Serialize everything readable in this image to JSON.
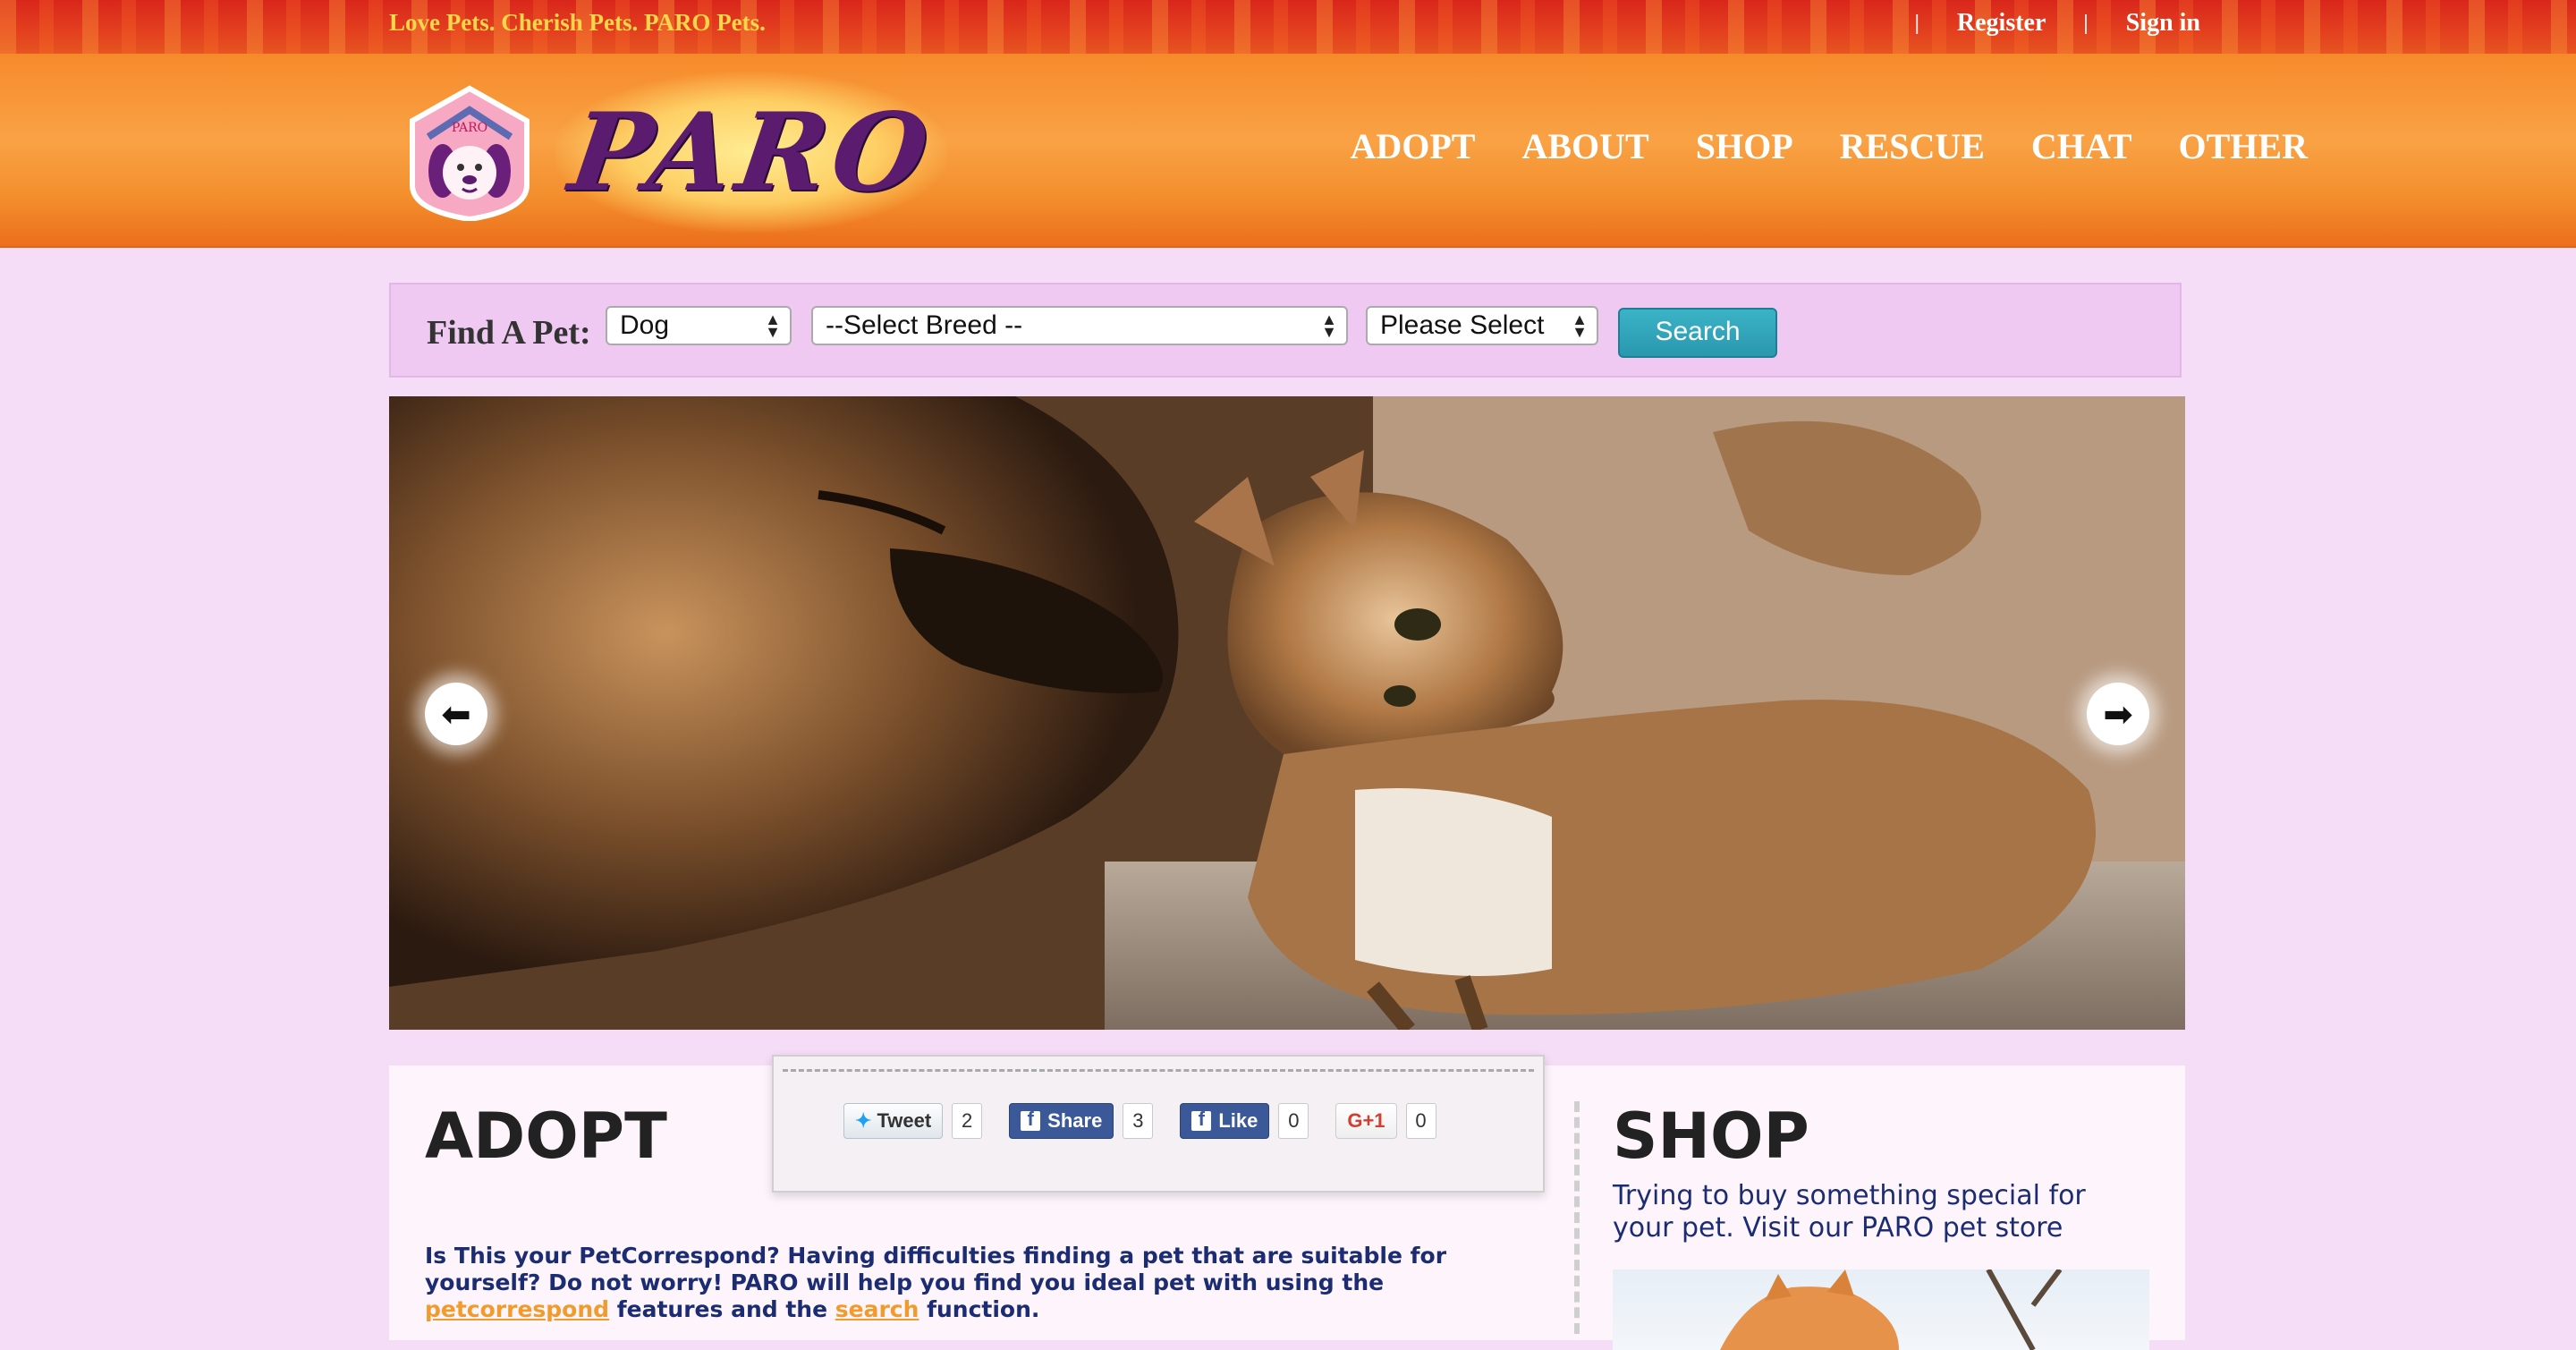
{
  "topbar": {
    "tagline": "Love Pets. Cherish Pets. PARO Pets.",
    "separator": "|",
    "register": "Register",
    "signin": "Sign in"
  },
  "header": {
    "badge_text": "PARO",
    "logo_text": "PARO",
    "nav": [
      "ADOPT",
      "ABOUT",
      "SHOP",
      "RESCUE",
      "CHAT",
      "OTHER"
    ]
  },
  "find": {
    "label": "Find A Pet:",
    "type_value": "Dog",
    "breed_value": "--Select Breed --",
    "third_value": "Please Select",
    "search_label": "Search"
  },
  "hero": {
    "prev_icon": "arrow-left-icon",
    "next_icon": "arrow-right-icon",
    "prev_glyph": "⬅",
    "next_glyph": "➡"
  },
  "adopt": {
    "title": "ADOPT",
    "text_1": "Is This your PetCorrespond? Having difficulties finding a pet that are suitable for yourself? Do not worry! PARO will help you find you ideal pet with using the ",
    "link_1": "petcorrespond",
    "text_2": " features and the ",
    "link_2": "search",
    "text_3": " function."
  },
  "share": {
    "tweet_label": "Tweet",
    "tweet_count": "2",
    "share_label": "Share",
    "share_count": "3",
    "like_label": "Like",
    "like_count": "0",
    "gplus_label": "G+1",
    "gplus_count": "0"
  },
  "shop": {
    "title": "SHOP",
    "text": "Trying to buy something special for your pet. Visit our PARO pet store"
  },
  "colors": {
    "page_bg": "#f5dcf7",
    "topbar_red": "#d9261c",
    "header_orange": "#f68a2a",
    "tagline_yellow": "#ffd54a",
    "text_navy": "#1c2c73",
    "link_orange": "#f19b2c",
    "search_teal": "#2a98ae",
    "logo_purple": "#5b1b6f"
  }
}
